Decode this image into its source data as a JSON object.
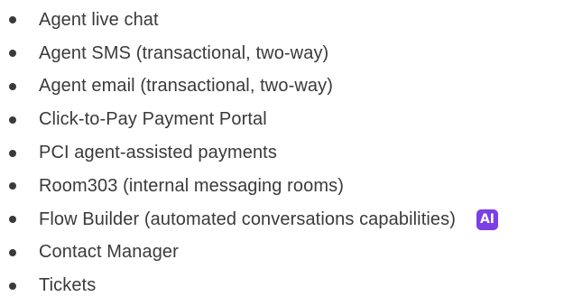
{
  "features": [
    {
      "label": "Agent live chat"
    },
    {
      "label": "Agent SMS (transactional, two-way)"
    },
    {
      "label": "Agent email (transactional, two-way)"
    },
    {
      "label": "Click-to-Pay Payment Portal"
    },
    {
      "label": "PCI agent-assisted payments"
    },
    {
      "label": "Room303 (internal messaging rooms)"
    },
    {
      "label": "Flow Builder (automated conversations capabilities)",
      "badge": "AI"
    },
    {
      "label": "Contact Manager"
    },
    {
      "label": "Tickets"
    }
  ],
  "colors": {
    "text": "#3a3a3a",
    "badge_background": "#7b3fe4",
    "badge_text": "#ffffff"
  }
}
